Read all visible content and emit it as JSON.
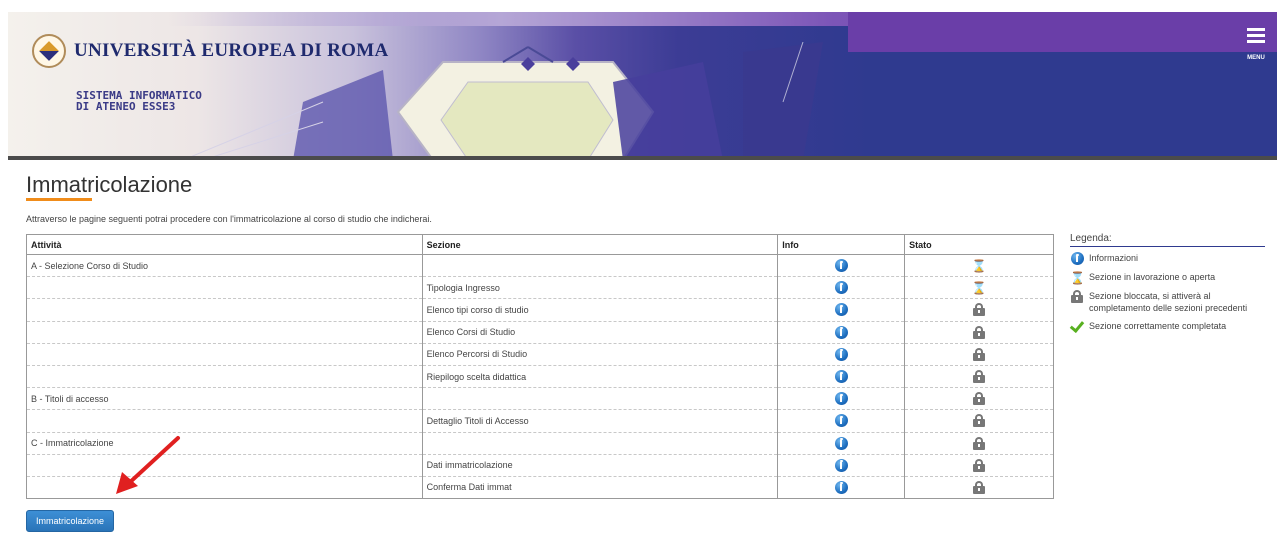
{
  "header": {
    "university_name": "UNIVERSITÀ EUROPEA DI ROMA",
    "system_title_line1": "SISTEMA INFORMATICO",
    "system_title_line2": "DI ATENEO ESSE3",
    "menu_label": "MENU"
  },
  "page": {
    "title": "Immatricolazione",
    "intro": "Attraverso le pagine seguenti potrai procedere con l'immatricolazione al corso di studio che indicherai."
  },
  "table": {
    "headers": [
      "Attività",
      "Sezione",
      "Info",
      "Stato"
    ],
    "rows": [
      {
        "attivita": "A - Selezione Corso di Studio",
        "sezione": "",
        "stato": "hourglass-icon"
      },
      {
        "attivita": "",
        "sezione": "Tipologia Ingresso",
        "stato": "hourglass-icon"
      },
      {
        "attivita": "",
        "sezione": "Elenco tipi corso di studio",
        "stato": "lock-icon"
      },
      {
        "attivita": "",
        "sezione": "Elenco Corsi di Studio",
        "stato": "lock-icon"
      },
      {
        "attivita": "",
        "sezione": "Elenco Percorsi di Studio",
        "stato": "lock-icon"
      },
      {
        "attivita": "",
        "sezione": "Riepilogo scelta didattica",
        "stato": "lock-icon"
      },
      {
        "attivita": "B - Titoli di accesso",
        "sezione": "",
        "stato": "lock-icon"
      },
      {
        "attivita": "",
        "sezione": "Dettaglio Titoli di Accesso",
        "stato": "lock-icon"
      },
      {
        "attivita": "C - Immatricolazione",
        "sezione": "",
        "stato": "lock-icon"
      },
      {
        "attivita": "",
        "sezione": "Dati immatricolazione",
        "stato": "lock-icon"
      },
      {
        "attivita": "",
        "sezione": "Conferma Dati immat",
        "stato": "lock-icon"
      }
    ]
  },
  "legend": {
    "title": "Legenda:",
    "items": [
      {
        "icon": "info-icon",
        "label": "Informazioni"
      },
      {
        "icon": "hourglass-icon",
        "label": "Sezione in lavorazione o aperta"
      },
      {
        "icon": "lock-icon",
        "label": "Sezione bloccata, si attiverà al completamento delle sezioni precedenti"
      },
      {
        "icon": "check-icon",
        "label": "Sezione correttamente completata"
      }
    ]
  },
  "actions": {
    "submit_label": "Immatricolazione"
  },
  "colors": {
    "banner_blue": "#2f3a8f",
    "accent_orange": "#f08c1a",
    "button_blue": "#2a74b8",
    "arrow_red": "#e02020"
  }
}
